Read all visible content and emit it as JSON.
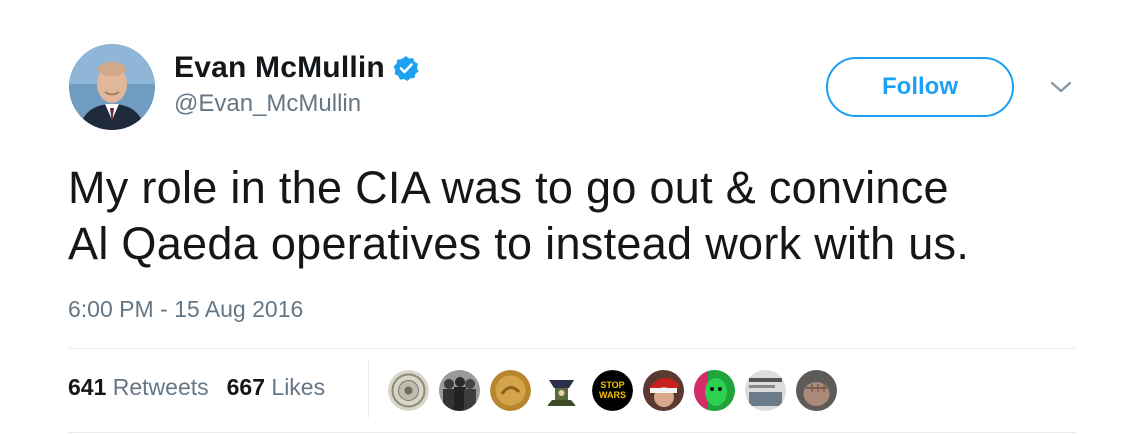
{
  "user": {
    "display_name": "Evan McMullin",
    "handle": "@Evan_McMullin",
    "verified": true,
    "avatar_icon": "profile-photo"
  },
  "actions": {
    "follow_label": "Follow",
    "more_icon": "chevron-down-icon"
  },
  "tweet": {
    "line1": "My role in the CIA was to go out & convince",
    "line2": "Al Qaeda operatives to instead work with us.",
    "timestamp": "6:00 PM - 15 Aug 2016"
  },
  "stats": {
    "retweets_count": "641",
    "retweets_label": "Retweets",
    "likes_count": "667",
    "likes_label": "Likes"
  },
  "likers": [
    {
      "name": "seal-avatar"
    },
    {
      "name": "group-photo-avatar"
    },
    {
      "name": "coin-avatar"
    },
    {
      "name": "cartoon-avatar"
    },
    {
      "name": "stop-wars-avatar",
      "text": "STOP WARS"
    },
    {
      "name": "santa-avatar"
    },
    {
      "name": "neon-face-avatar"
    },
    {
      "name": "screenshot-avatar"
    },
    {
      "name": "fist-avatar"
    }
  ],
  "colors": {
    "accent": "#1da1f2",
    "text": "#14171a",
    "secondary": "#657786",
    "border": "#e6ecf0"
  }
}
